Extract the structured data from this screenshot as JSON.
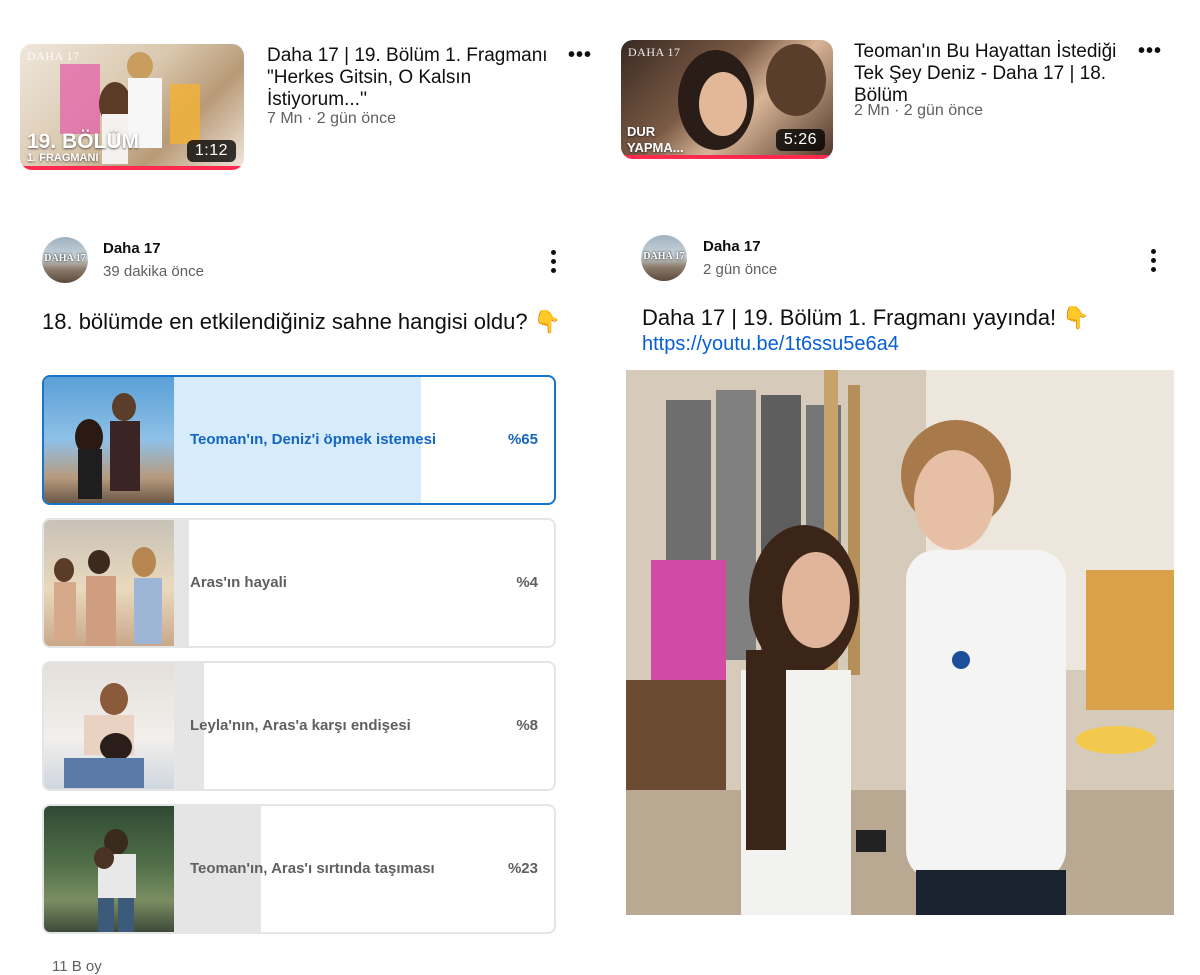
{
  "videos": [
    {
      "brand": "DAHA 17",
      "overlay_line1": "19. BÖLÜM",
      "overlay_line2": "1. FRAGMANI",
      "duration": "1:12",
      "title": "Daha 17 | 19. Bölüm 1. Fragmanı \"Herkes Gitsin, O Kalsın İstiyorum...''",
      "meta": "7 Mn · 2 gün önce"
    },
    {
      "brand": "DAHA 17",
      "overlay_line1": "DUR",
      "overlay_line2": "YAPMA...",
      "duration": "5:26",
      "title": "Teoman'ın Bu Hayattan İstediği Tek Şey Deniz - Daha 17 | 18. Bölüm",
      "meta": "2 Mn · 2 gün önce"
    }
  ],
  "poll_post": {
    "avatar_text": "DAHA 17",
    "channel": "Daha 17",
    "time": "39 dakika önce",
    "question": "18. bölümde en etkilendiğiniz sahne hangisi oldu? 👇",
    "options": [
      {
        "label": "Teoman'ın, Deniz'i öpmek istemesi",
        "percent_text": "%65",
        "percent": 65,
        "selected": true
      },
      {
        "label": "Aras'ın hayali",
        "percent_text": "%4",
        "percent": 4,
        "selected": false
      },
      {
        "label": "Leyla'nın, Aras'a karşı endişesi",
        "percent_text": "%8",
        "percent": 8,
        "selected": false
      },
      {
        "label": "Teoman'ın, Aras'ı sırtında taşıması",
        "percent_text": "%23",
        "percent": 23,
        "selected": false
      }
    ],
    "votes": "11 B oy"
  },
  "image_post": {
    "avatar_text": "DAHA 17",
    "channel": "Daha 17",
    "time": "2 gün önce",
    "text": "Daha 17 | 19. Bölüm 1. Fragmanı yayında! 👇",
    "link": "https://youtu.be/1t6ssu5e6a4"
  },
  "icons": {
    "more_horizontal": "more-horizontal-icon",
    "more_vertical": "more-vertical-icon"
  },
  "colors": {
    "selected_border": "#1a73c8",
    "selected_fill": "#d6ecfd",
    "selected_text": "#1565c0",
    "bar_fill": "#e5e5e5",
    "link": "#065fd4",
    "progress": "#ff2a4d"
  }
}
